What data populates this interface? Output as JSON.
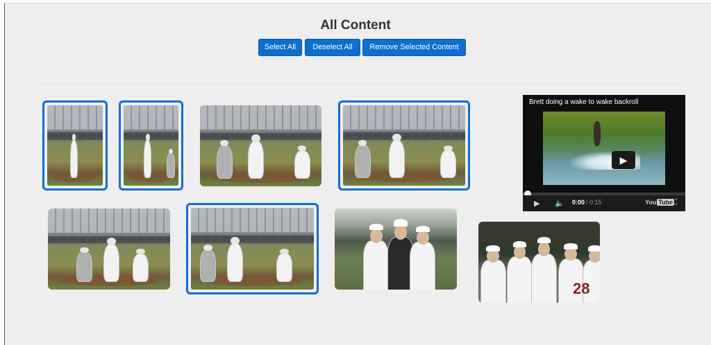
{
  "header": {
    "title": "All Content"
  },
  "toolbar": {
    "select_all_label": "Select All",
    "deselect_all_label": "Deselect All",
    "remove_selected_label": "Remove Selected Content"
  },
  "gallery": {
    "items": [
      {
        "kind": "photo",
        "selected": true
      },
      {
        "kind": "photo",
        "selected": true
      },
      {
        "kind": "photo",
        "selected": false
      },
      {
        "kind": "photo",
        "selected": true
      },
      {
        "kind": "photo",
        "selected": false
      },
      {
        "kind": "photo",
        "selected": true
      },
      {
        "kind": "photo",
        "selected": false
      },
      {
        "kind": "photo",
        "selected": false,
        "jersey_number": "28"
      }
    ]
  },
  "video": {
    "title": "Brett doing a wake to wake backroll",
    "current_time": "0:00",
    "duration": "/ 0:15",
    "progress_fraction": 0,
    "brand_text": "You",
    "brand_badge": "Tube"
  },
  "colors": {
    "accent": "#0d6fcf",
    "panel_bg": "#eeeeee",
    "video_bg": "#0f0f0f"
  },
  "icons": {
    "play": "play-icon",
    "volume": "volume-icon",
    "fullscreen": "fullscreen-icon"
  }
}
